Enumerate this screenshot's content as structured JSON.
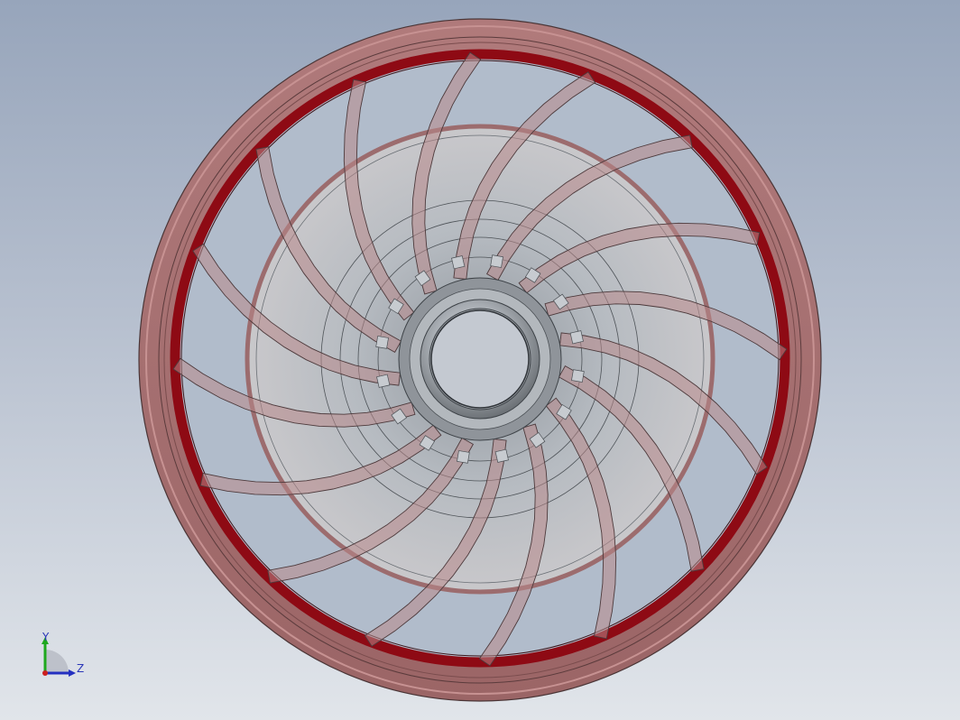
{
  "viewport": {
    "model": "fan-impeller",
    "blade_count": 16
  },
  "triad": {
    "y_label": "Y",
    "z_label": "Z",
    "y_color": "#1ea81e",
    "z_color": "#2430c0"
  },
  "colors": {
    "rim": "#a26a6a",
    "rim_highlight": "#c79292",
    "inner_ring": "#8e0a14",
    "blade": "#b8898b",
    "shroud_fill": "#b9bdc2",
    "hub": "#a9aeb4"
  }
}
